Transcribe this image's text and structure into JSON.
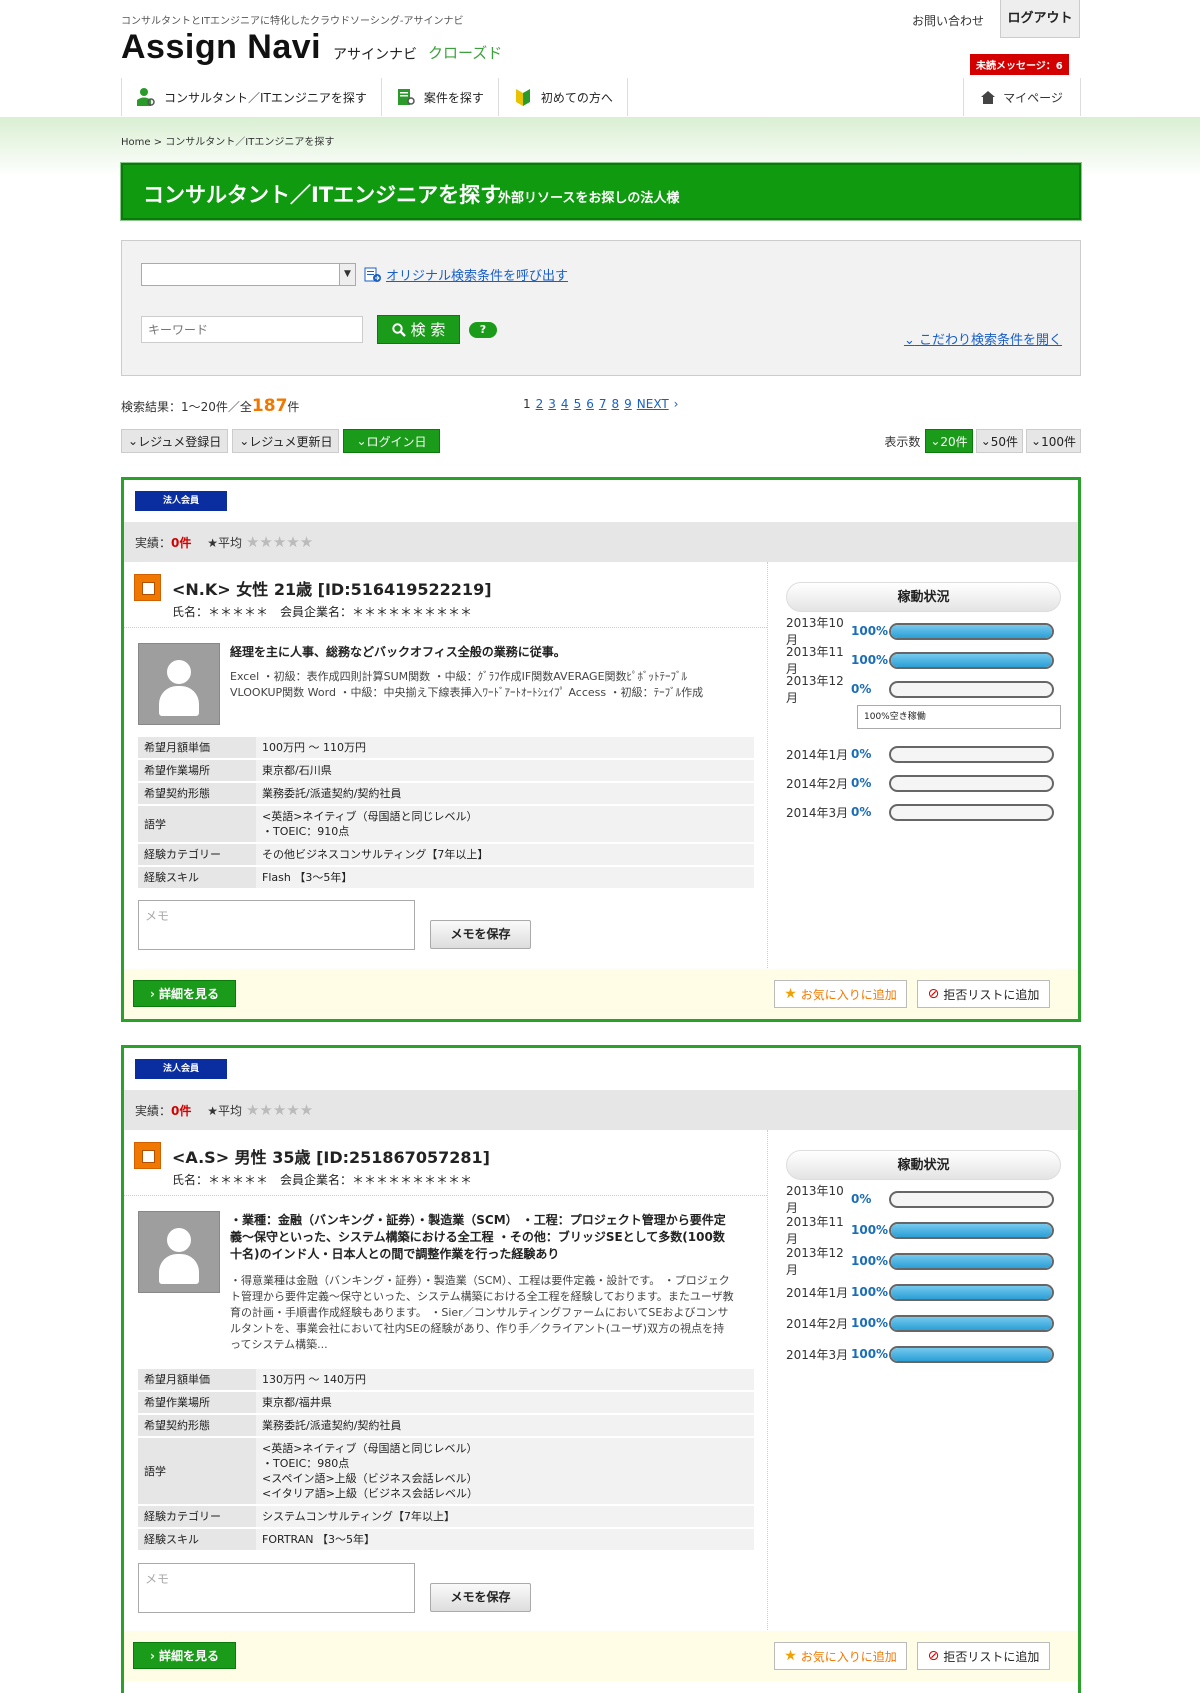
{
  "header": {
    "tagline": "コンサルタントとITエンジニアに特化したクラウドソーシング-アサインナビ",
    "logo": "Assign Navi",
    "logo_sub": "アサインナビ",
    "logo_closed": "クローズド",
    "contact": "お問い合わせ",
    "logout": "ログアウト",
    "unread": "未読メッセージ：6",
    "mypage": "マイページ",
    "nav": [
      {
        "label": "コンサルタント／ITエンジニアを探す"
      },
      {
        "label": "案件を探す"
      },
      {
        "label": "初めての方へ"
      }
    ]
  },
  "breadcrumb": "Home > コンサルタント／ITエンジニアを探す",
  "title": {
    "main": "コンサルタント／ITエンジニアを探す",
    "sub": "外部リソースをお探しの法人様"
  },
  "search": {
    "original_link": "オリジナル検索条件を呼び出す",
    "keyword_placeholder": "キーワード",
    "search_label": "検 索",
    "help": "?",
    "detail_link": "こだわり検索条件を開く"
  },
  "results": {
    "prefix": "検索結果：1～20件／全",
    "total": "187",
    "suffix": "件",
    "pages": [
      "1",
      "2",
      "3",
      "4",
      "5",
      "6",
      "7",
      "8",
      "9"
    ],
    "next": "NEXT"
  },
  "sort": {
    "buttons": [
      "レジュメ登録日",
      "レジュメ更新日",
      "ログイン日"
    ],
    "perpage_label": "表示数",
    "perpage": [
      "20件",
      "50件",
      "100件"
    ]
  },
  "cards": [
    {
      "badge": "法人会員",
      "record_label": "実績：",
      "record_value": "0件",
      "avg_label": "★平均",
      "stars": "★★★★★",
      "name": "<N.K> 女性 21歳 [ID:516419522219]",
      "meta": "氏名：＊＊＊＊＊　会員企業名：＊＊＊＊＊＊＊＊＊＊",
      "summary": "経理を主に人事、総務などバックオフィス全般の業務に従事。",
      "desc": "Excel ・初級：表作成四則計算SUM関数 ・中級：ｸﾞﾗﾌ作成IF関数AVERAGE関数ﾋﾟﾎﾞｯﾄﾃｰﾌﾞﾙVLOOKUP関数 Word ・中級：中央揃え下線表挿入ﾜｰﾄﾞｱｰﾄｵｰﾄｼｪｲﾌﾟ Access ・初級：ﾃｰﾌﾞﾙ作成",
      "rows": [
        {
          "h": "希望月額単価",
          "v": "100万円 ～ 110万円"
        },
        {
          "h": "希望作業場所",
          "v": "東京都/石川県"
        },
        {
          "h": "希望契約形態",
          "v": "業務委託/派遣契約/契約社員"
        },
        {
          "h": "語学",
          "v": "<英語>ネイティブ（母国語と同じレベル）\n・TOEIC：910点"
        },
        {
          "h": "経験カテゴリー",
          "v": "その他ビジネスコンサルティング【7年以上】"
        },
        {
          "h": "経験スキル",
          "v": "Flash 【3～5年】"
        }
      ],
      "memo_placeholder": "メモ",
      "memo_save": "メモを保存",
      "op_title": "稼動状況",
      "op": [
        {
          "month": "2013年10月",
          "pct": "100%",
          "fill": 1.0
        },
        {
          "month": "2013年11月",
          "pct": "100%",
          "fill": 1.0
        },
        {
          "month": "2013年12月",
          "pct": "0%",
          "fill": 0.0
        },
        {
          "month": "2014年1月",
          "pct": "0%",
          "fill": 0.0
        },
        {
          "month": "2014年2月",
          "pct": "0%",
          "fill": 0.0
        },
        {
          "month": "2014年3月",
          "pct": "0%",
          "fill": 0.0
        }
      ],
      "op_tip": "100%空き稼働",
      "detail": "詳細を見る",
      "fav": "お気に入りに追加",
      "block": "拒否リストに追加"
    },
    {
      "badge": "法人会員",
      "record_label": "実績：",
      "record_value": "0件",
      "avg_label": "★平均",
      "stars": "★★★★★",
      "name": "<A.S> 男性 35歳 [ID:251867057281]",
      "meta": "氏名：＊＊＊＊＊　会員企業名：＊＊＊＊＊＊＊＊＊＊",
      "summary": "・業種：金融（バンキング・証券）・製造業（SCM） ・工程：プロジェクト管理から要件定義～保守といった、システム構築における全工程 ・その他：ブリッジSEとして多数(100数十名)のインド人・日本人との間で調整作業を行った経験あり",
      "desc": "・得意業種は金融（バンキング・証券）・製造業（SCM）、工程は要件定義・設計です。 ・プロジェクト管理から要件定義～保守といった、システム構築における全工程を経験しております。またユーザ教育の計画・手順書作成経験もあります。 ・Sier／コンサルティングファームにおいてSEおよびコンサルタントを、事業会社において社内SEの経験があり、作り手／クライアント(ユーザ)双方の視点を持ってシステム構築...",
      "rows": [
        {
          "h": "希望月額単価",
          "v": "130万円 ～ 140万円"
        },
        {
          "h": "希望作業場所",
          "v": "東京都/福井県"
        },
        {
          "h": "希望契約形態",
          "v": "業務委託/派遣契約/契約社員"
        },
        {
          "h": "語学",
          "v": "<英語>ネイティブ（母国語と同じレベル）\n・TOEIC：980点\n<スペイン語>上級（ビジネス会話レベル）\n<イタリア語>上級（ビジネス会話レベル）"
        },
        {
          "h": "経験カテゴリー",
          "v": "システムコンサルティング【7年以上】"
        },
        {
          "h": "経験スキル",
          "v": "FORTRAN 【3～5年】"
        }
      ],
      "memo_placeholder": "メモ",
      "memo_save": "メモを保存",
      "op_title": "稼動状況",
      "op": [
        {
          "month": "2013年10月",
          "pct": "0%",
          "fill": 0.0
        },
        {
          "month": "2013年11月",
          "pct": "100%",
          "fill": 1.0
        },
        {
          "month": "2013年12月",
          "pct": "100%",
          "fill": 1.0
        },
        {
          "month": "2014年1月",
          "pct": "100%",
          "fill": 1.0
        },
        {
          "month": "2014年2月",
          "pct": "100%",
          "fill": 1.0
        },
        {
          "month": "2014年3月",
          "pct": "100%",
          "fill": 1.0
        }
      ],
      "op_tip": "",
      "detail": "詳細を見る",
      "fav": "お気に入りに追加",
      "block": "拒否リストに追加"
    }
  ]
}
